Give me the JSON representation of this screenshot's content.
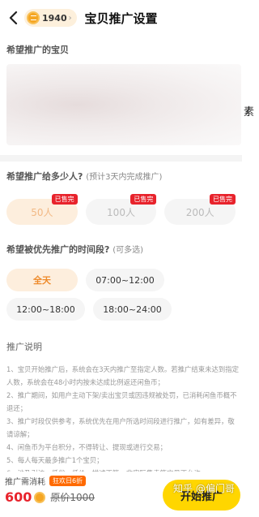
{
  "header": {
    "title": "宝贝推广设置",
    "coin_count": "1940",
    "coin_chevron": "›",
    "back_icon": "chevron-left-icon"
  },
  "product": {
    "label": "希望推广的宝贝"
  },
  "audience": {
    "label": "希望推广给多少人?",
    "hint": "(预计3天内完成推广)",
    "options": [
      {
        "label": "50人",
        "badge": "已售完",
        "selected": true
      },
      {
        "label": "100人",
        "badge": "已售完",
        "selected": false
      },
      {
        "label": "200人",
        "badge": "已售完",
        "selected": false
      }
    ]
  },
  "time": {
    "label": "希望被优先推广的时间段?",
    "hint": "(可多选)",
    "options": [
      {
        "label": "全天",
        "selected": true
      },
      {
        "label": "07:00~12:00",
        "selected": false
      },
      {
        "label": "12:00~18:00",
        "selected": false
      },
      {
        "label": "18:00~24:00",
        "selected": false
      }
    ]
  },
  "description": {
    "title": "推广说明",
    "items": [
      "1、宝贝开始推广后，系统会在3天内推广至指定人数。若推广结束未达到指定人数，系统会在48小时内按未达成比例返还闲鱼币；",
      "2、推广期间，如用户主动下架/卖出宝贝或因违规被处罚，已消耗闲鱼币概不退还；",
      "3、推广时段仅供参考，系统优先在用户所选时间段进行推广，如有差异，敬请谅解；",
      "4、闲鱼币为平台积分，不得转让、提现或进行交易；",
      "5、每人每天最多推广1个宝贝；",
      "6、涉及引流、低俗、低价、描述不符、非实际售卖等宝贝不允许"
    ]
  },
  "footer": {
    "cost_label": "推广需消耗",
    "discount": "狂欢日6折",
    "price": "600",
    "original": "原价1000",
    "button": "开始推广"
  },
  "watermark": "知乎 @偏门哥",
  "edge_char": "素",
  "colors": {
    "accent": "#ffd600",
    "price_red": "#e8232c",
    "selected_bg": "#fdeedd",
    "selected_text": "#ee8a2a"
  }
}
